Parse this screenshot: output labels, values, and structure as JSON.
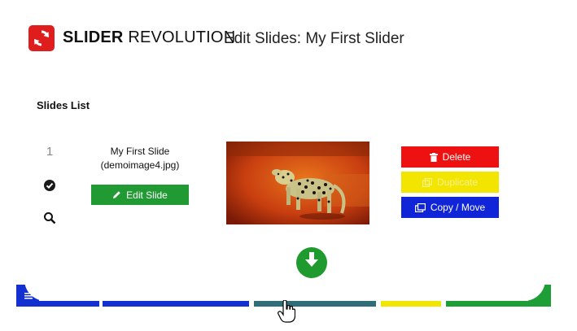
{
  "header": {
    "brand_bold": "SLIDER",
    "brand_light": "REVOLUTION",
    "page_title": "Edit Slides: My First Slider",
    "logo_color": "#e01d1d"
  },
  "slides_list": {
    "title": "Slides List",
    "slides": [
      {
        "number": "1",
        "name": "My First Slide",
        "image": "(demoimage4.jpg)",
        "edit_label": "Edit Slide",
        "actions": {
          "delete": "Delete",
          "duplicate": "Duplicate",
          "copy_move": "Copy / Move"
        },
        "status_icon": "check-circle-icon",
        "preview_icon": "search-icon"
      }
    ]
  },
  "colors": {
    "edit": "#229a33",
    "delete": "#ee1111",
    "duplicate": "#f2e600",
    "copy_move": "#1024d8",
    "add": "#1f9a2e"
  }
}
